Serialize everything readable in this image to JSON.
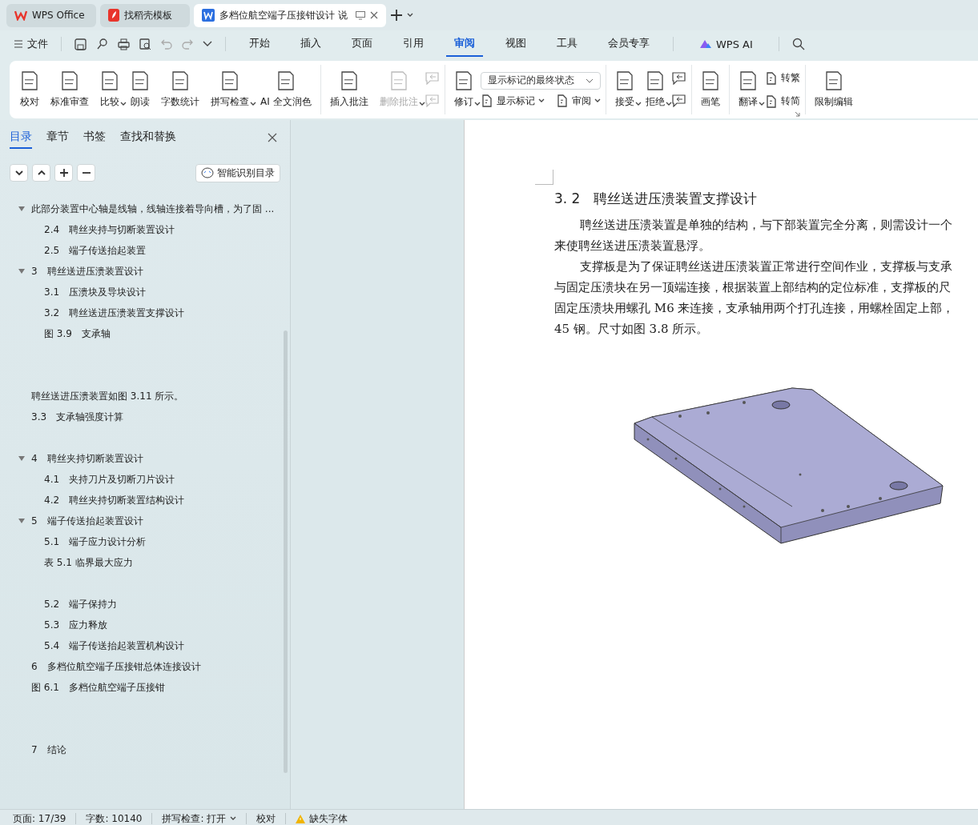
{
  "browser_tabs": [
    {
      "label": "WPS Office",
      "selected": false,
      "kind": "wps"
    },
    {
      "label": "找稻壳模板",
      "selected": false,
      "kind": "template"
    },
    {
      "label": "多档位航空端子压接钳设计 说",
      "selected": true,
      "kind": "doc"
    }
  ],
  "menu": {
    "file": "文件",
    "tabs": [
      {
        "label": "开始",
        "selected": false
      },
      {
        "label": "插入",
        "selected": false
      },
      {
        "label": "页面",
        "selected": false
      },
      {
        "label": "引用",
        "selected": false
      },
      {
        "label": "审阅",
        "selected": true
      },
      {
        "label": "视图",
        "selected": false
      },
      {
        "label": "工具",
        "selected": false
      },
      {
        "label": "会员专享",
        "selected": false
      }
    ],
    "ai": "WPS AI"
  },
  "ribbon": {
    "groups": [
      {
        "columns": [
          {
            "kind": "large",
            "label": "校对",
            "dropdown": false,
            "disabled": false
          },
          {
            "kind": "large",
            "label": "标准审查",
            "dropdown": false,
            "disabled": false
          },
          {
            "kind": "large",
            "label": "比较",
            "dropdown": true,
            "disabled": false
          },
          {
            "kind": "large",
            "label": "朗读",
            "dropdown": false,
            "disabled": false
          },
          {
            "kind": "large",
            "label": "字数统计",
            "dropdown": false,
            "disabled": false
          },
          {
            "kind": "large",
            "label": "拼写检查",
            "dropdown": true,
            "disabled": false
          },
          {
            "kind": "large",
            "label": "AI 全文润色",
            "dropdown": false,
            "disabled": false
          }
        ]
      },
      {
        "columns": [
          {
            "kind": "large",
            "label": "插入批注",
            "dropdown": false,
            "disabled": false
          },
          {
            "kind": "large",
            "label": "删除批注",
            "dropdown": true,
            "disabled": true
          },
          {
            "kind": "icons",
            "items": [
              {
                "disabled": true
              },
              {
                "disabled": true
              }
            ]
          }
        ]
      },
      {
        "columns": [
          {
            "kind": "large",
            "label": "修订",
            "dropdown": true,
            "disabled": false
          },
          {
            "kind": "select",
            "value": "显示标记的最终状态",
            "items": [
              {
                "label": "显示标记",
                "dropdown": true
              },
              {
                "label": "审阅",
                "dropdown": true
              }
            ]
          }
        ]
      },
      {
        "columns": [
          {
            "kind": "large",
            "label": "接受",
            "dropdown": true,
            "disabled": false
          },
          {
            "kind": "large",
            "label": "拒绝",
            "dropdown": true,
            "disabled": false
          },
          {
            "kind": "icons",
            "items": [
              {
                "disabled": false
              },
              {
                "disabled": false
              }
            ]
          }
        ]
      },
      {
        "columns": [
          {
            "kind": "large",
            "label": "画笔",
            "dropdown": false,
            "disabled": false
          }
        ]
      },
      {
        "columns": [
          {
            "kind": "large",
            "label": "翻译",
            "dropdown": true,
            "disabled": false
          },
          {
            "kind": "stack",
            "items": [
              {
                "label": "转繁"
              },
              {
                "label": "转简"
              }
            ]
          }
        ]
      },
      {
        "columns": [
          {
            "kind": "large",
            "label": "限制编辑",
            "dropdown": false,
            "disabled": false
          }
        ]
      }
    ]
  },
  "nav_panel": {
    "tabs": [
      {
        "label": "目录",
        "selected": true
      },
      {
        "label": "章节",
        "selected": false
      },
      {
        "label": "书签",
        "selected": false
      },
      {
        "label": "查找和替换",
        "selected": false
      }
    ],
    "smart_button": "智能识别目录",
    "toc": [
      {
        "label": "此部分装置中心轴是线轴，线轴连接着导向槽，为了固 ...",
        "expanded": true,
        "kind": "plain",
        "children": [
          {
            "label": "2.4　聘丝夹持与切断装置设计",
            "kind": "plain"
          },
          {
            "label": "2.5　端子传送抬起装置",
            "kind": "plain"
          }
        ]
      },
      {
        "label": "3　聘丝送进压溃装置设计",
        "expanded": true,
        "kind": "plain",
        "children": [
          {
            "label": "3.1　压溃块及导块设计",
            "kind": "plain"
          },
          {
            "label": "3.2　聘丝送进压溃装置支撑设计",
            "kind": "plain"
          },
          {
            "label": "图 3.9　支承轴",
            "kind": "plain"
          }
        ]
      },
      {
        "label": "聘丝送进压溃装置如图 3.11 所示。",
        "kind": "gap2"
      },
      {
        "label": "3.3　支承轴强度计算",
        "kind": "plain"
      },
      {
        "label": "4　聘丝夹持切断装置设计",
        "expanded": true,
        "kind": "gap1",
        "children": [
          {
            "label": "4.1　夹持刀片及切断刀片设计",
            "kind": "plain"
          },
          {
            "label": "4.2　聘丝夹持切断装置结构设计",
            "kind": "plain"
          }
        ]
      },
      {
        "label": "5　端子传送抬起装置设计",
        "expanded": true,
        "kind": "plain",
        "children": [
          {
            "label": "5.1　端子应力设计分析",
            "kind": "plain"
          },
          {
            "label": "表 5.1 临界最大应力",
            "kind": "plain"
          },
          {
            "label": "5.2　端子保持力",
            "kind": "gap1"
          },
          {
            "label": "5.3　应力释放",
            "kind": "plain"
          },
          {
            "label": "5.4　端子传送抬起装置机构设计",
            "kind": "plain"
          }
        ]
      },
      {
        "label": "6　多档位航空端子压接钳总体连接设计",
        "kind": "plain"
      },
      {
        "label": "图 6.1　多档位航空端子压接钳",
        "kind": "plain"
      },
      {
        "label": "7　结论",
        "kind": "gap2"
      }
    ]
  },
  "document": {
    "heading": "3. 2　聘丝送进压溃装置支撑设计",
    "lines": [
      {
        "text": "聘丝送进压溃装置是单独的结构，与下部装置完全分离，则需设计一个",
        "indent": true
      },
      {
        "text": "来使聘丝送进压溃装置悬浮。",
        "indent": false
      },
      {
        "text": "支撑板是为了保证聘丝送进压溃装置正常进行空间作业，支撑板与支承",
        "indent": true
      },
      {
        "text": "与固定压溃块在另一顶端连接，根据装置上部结构的定位标准，支撑板的尺",
        "indent": false
      },
      {
        "text": "固定压溃块用螺孔 M6 来连接，支承轴用两个打孔连接，用螺栓固定上部，",
        "indent": false
      },
      {
        "text": "45 钢。尺寸如图 3.8 所示。",
        "indent": false
      }
    ]
  },
  "status_bar": [
    {
      "label": "页面: 17/39",
      "kind": "text"
    },
    {
      "label": "字数: 10140",
      "kind": "text"
    },
    {
      "label": "拼写检查: 打开",
      "kind": "dropdown"
    },
    {
      "label": "校对",
      "kind": "text"
    },
    {
      "label": "缺失字体",
      "kind": "warning"
    }
  ]
}
